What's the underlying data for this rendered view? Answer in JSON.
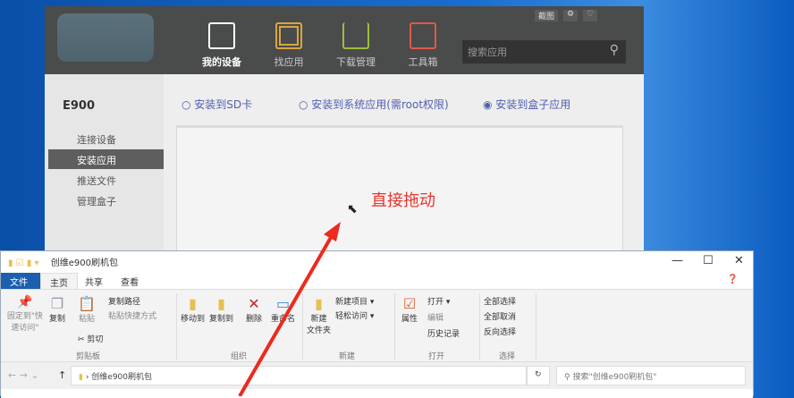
{
  "app": {
    "top_buttons": [
      "截图",
      "⚙",
      "♡"
    ],
    "nav": [
      {
        "label": "我的设备",
        "color": "#ffffff",
        "icon": "tablet-icon"
      },
      {
        "label": "找应用",
        "color": "#d9a640",
        "icon": "apps-grid-icon"
      },
      {
        "label": "下载管理",
        "color": "#9bbf3a",
        "icon": "download-icon"
      },
      {
        "label": "工具箱",
        "color": "#e0584c",
        "icon": "toolbox-icon"
      }
    ],
    "search_placeholder": "搜索应用",
    "device": "E900",
    "sidebar": [
      "连接设备",
      "安装应用",
      "推送文件",
      "管理盒子"
    ],
    "selected_sidebar": "安装应用",
    "install_options": [
      {
        "label": "安装到SD卡",
        "checked": false
      },
      {
        "label": "安装到系统应用(需root权限)",
        "checked": false
      },
      {
        "label": "安装到盒子应用",
        "checked": true
      }
    ]
  },
  "annotation": "直接拖动",
  "explorer": {
    "title": "创维e900刷机包",
    "tabs": [
      "文件",
      "主页",
      "共享",
      "查看"
    ],
    "clipboard": {
      "pin": "固定到\"快速访问\"",
      "copy": "复制",
      "paste": "粘贴",
      "copy_path": "复制路径",
      "paste_shortcut": "粘贴快捷方式",
      "cut": "剪切",
      "group": "剪贴板"
    },
    "organize": {
      "move": "移动到",
      "copy_to": "复制到",
      "delete": "删除",
      "rename": "重命名",
      "group": "组织"
    },
    "new": {
      "folder": "新建\n文件夹",
      "new_item": "新建项目 ▾",
      "easy_access": "轻松访问 ▾",
      "group": "新建"
    },
    "open": {
      "properties": "属性",
      "open": "打开 ▾",
      "edit": "编辑",
      "history": "历史记录",
      "group": "打开"
    },
    "select": {
      "all": "全部选择",
      "none": "全部取消",
      "invert": "反向选择",
      "group": "选择"
    },
    "path": "创维e900刷机包",
    "search_placeholder": "搜索\"创维e900刷机包\""
  }
}
